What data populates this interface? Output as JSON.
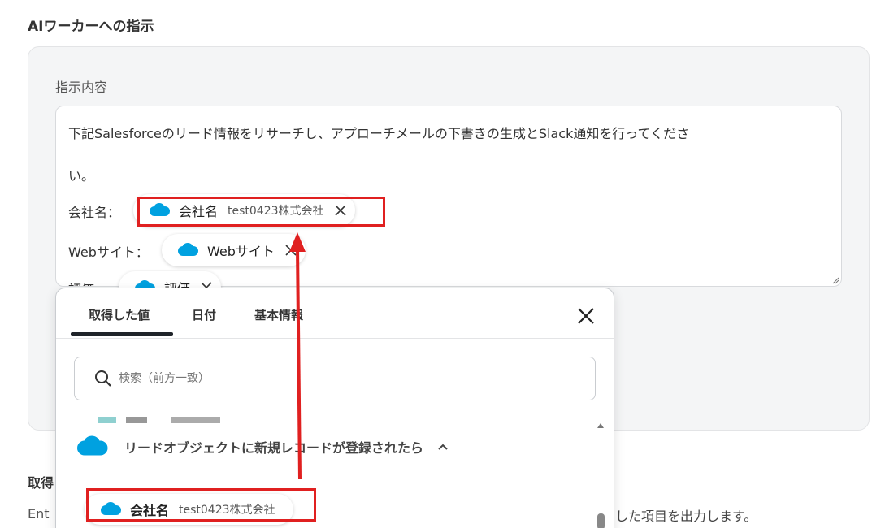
{
  "section": {
    "title": "AIワーカーへの指示"
  },
  "instruction": {
    "label": "指示内容",
    "text_line1": "下記Salesforceのリード情報をリサーチし、アプローチメールの下書きの生成とSlack通知を行ってくださ",
    "text_line2": "い。",
    "company_label": "会社名：",
    "website_label": "Webサイト：",
    "rating_label": "評価：",
    "company_chip": {
      "name": "会社名",
      "value": "test0423株式会社"
    },
    "website_chip": {
      "name": "Webサイト"
    },
    "rating_chip": {
      "name": "評価"
    }
  },
  "below": {
    "title": "取得",
    "desc_left": "Ent",
    "desc_right": "した項目を出力します。"
  },
  "popup": {
    "tabs": [
      {
        "label": "取得した値",
        "active": true
      },
      {
        "label": "日付",
        "active": false
      },
      {
        "label": "基本情報",
        "active": false
      }
    ],
    "search_placeholder": "検索（前方一致）",
    "group_label": "リードオブジェクトに新規レコードが登録されたら",
    "item": {
      "name": "会社名",
      "value": "test0423株式会社"
    }
  },
  "colors": {
    "salesforce_blue": "#00a1e0",
    "highlight_red": "#e02020",
    "panel_bg": "#f4f5f6"
  },
  "icons": [
    "salesforce-cloud-icon",
    "close-icon",
    "search-icon",
    "chevron-up-icon"
  ]
}
